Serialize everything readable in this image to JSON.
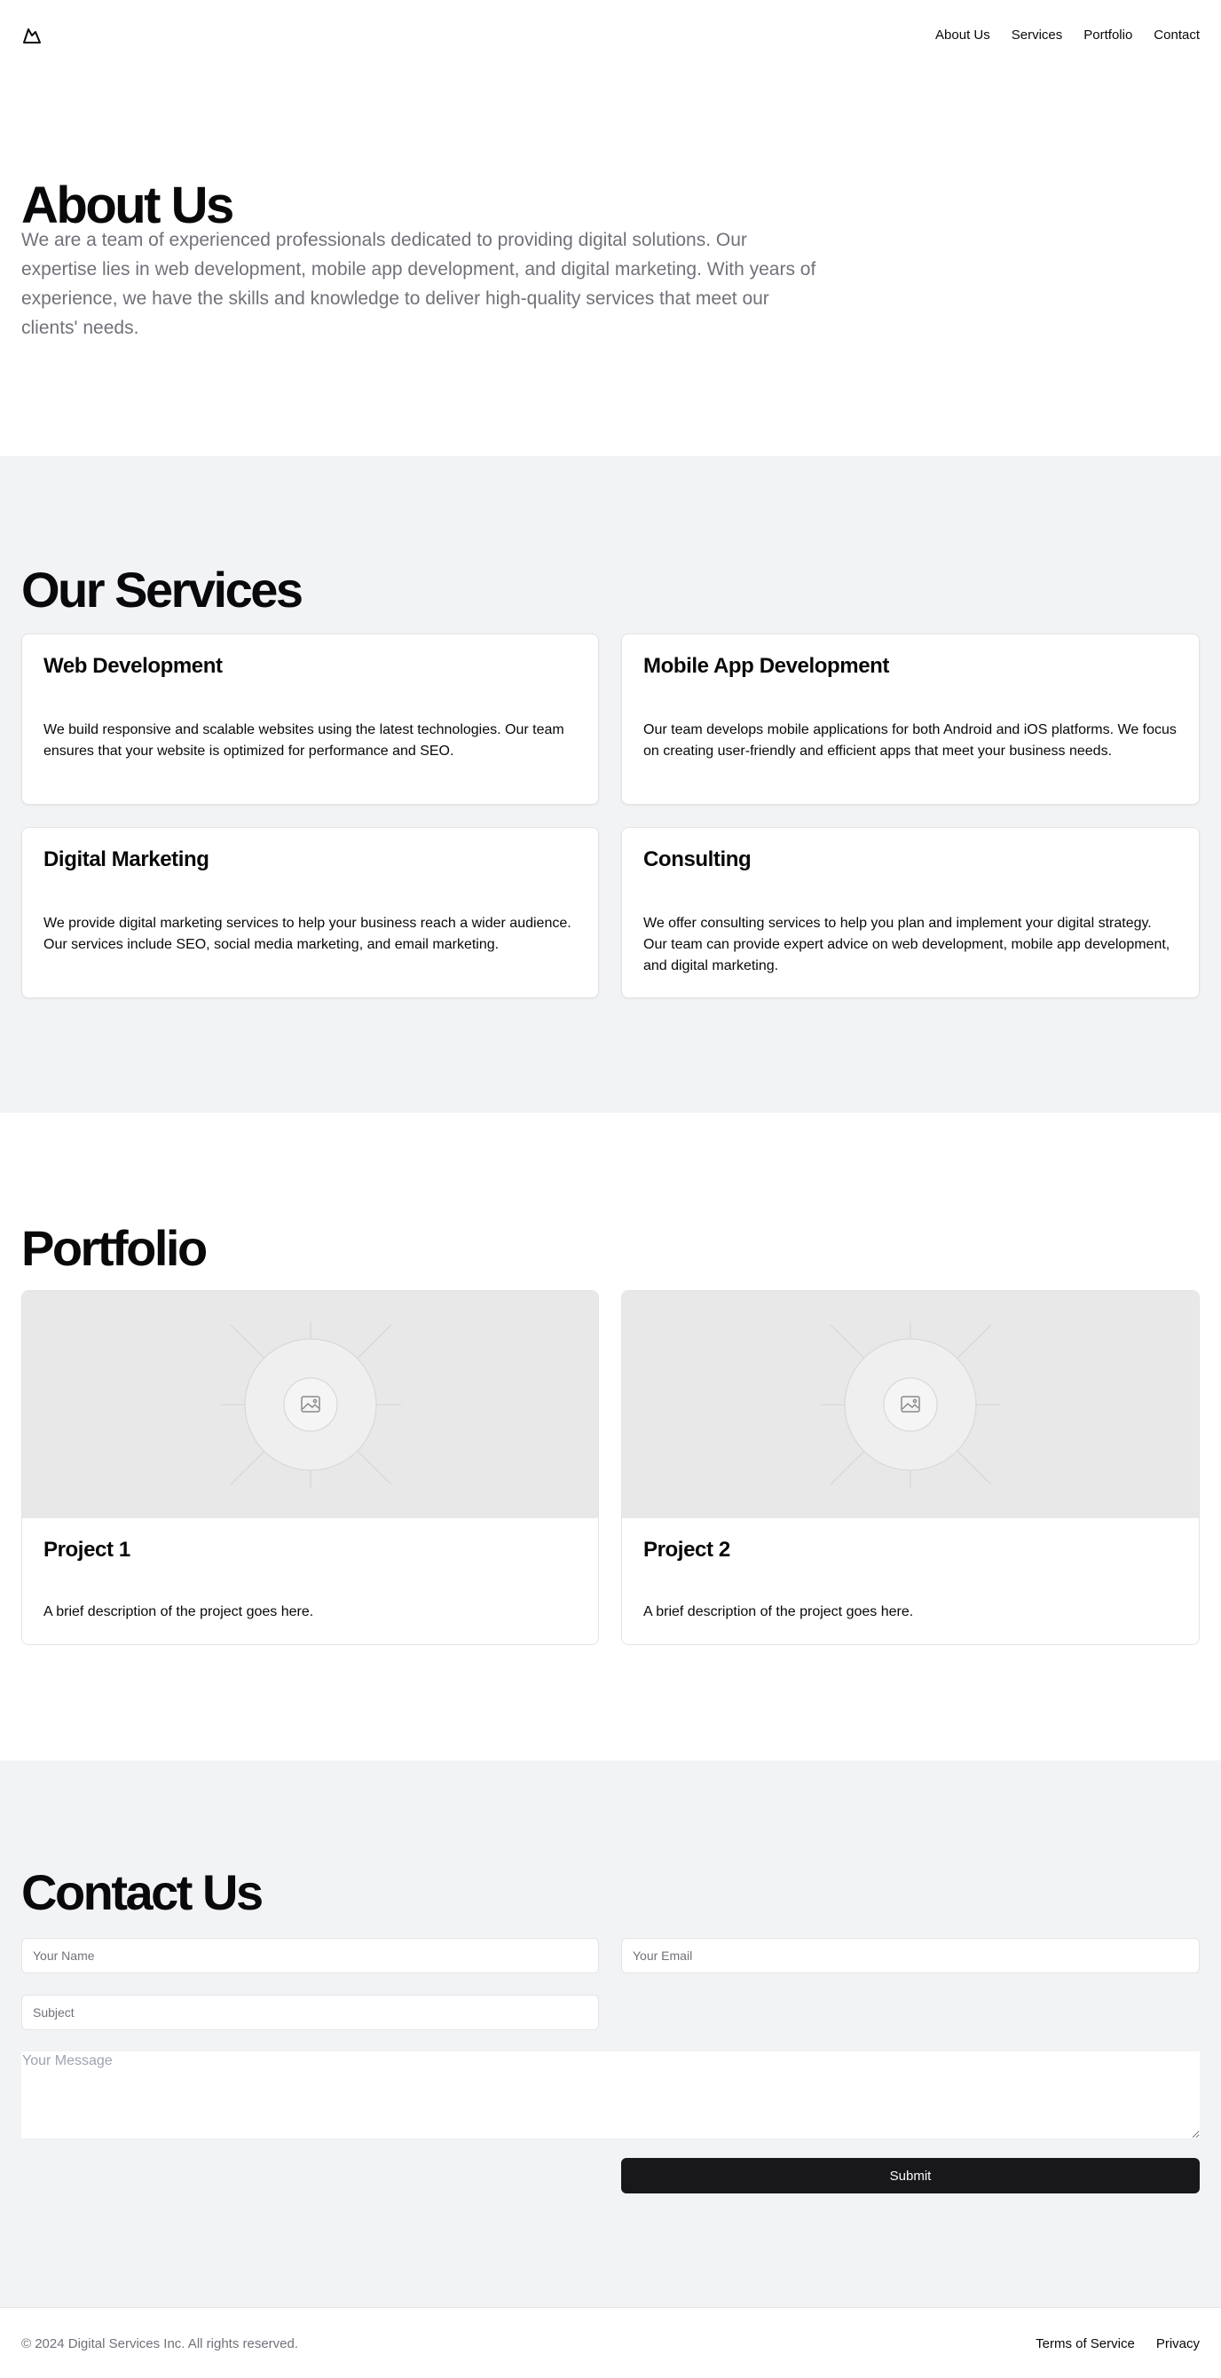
{
  "header": {
    "logo_icon": "mountain-icon",
    "nav": [
      {
        "label": "About Us"
      },
      {
        "label": "Services"
      },
      {
        "label": "Portfolio"
      },
      {
        "label": "Contact"
      }
    ]
  },
  "about": {
    "title": "About Us",
    "body": "We are a team of experienced professionals dedicated to providing digital solutions. Our expertise lies in web development, mobile app development, and digital marketing. With years of experience, we have the skills and knowledge to deliver high-quality services that meet our clients' needs."
  },
  "services": {
    "title": "Our Services",
    "items": [
      {
        "title": "Web Development",
        "body": "We build responsive and scalable websites using the latest technologies. Our team ensures that your website is optimized for performance and SEO."
      },
      {
        "title": "Mobile App Development",
        "body": "Our team develops mobile applications for both Android and iOS platforms. We focus on creating user-friendly and efficient apps that meet your business needs."
      },
      {
        "title": "Digital Marketing",
        "body": "We provide digital marketing services to help your business reach a wider audience. Our services include SEO, social media marketing, and email marketing."
      },
      {
        "title": "Consulting",
        "body": "We offer consulting services to help you plan and implement your digital strategy. Our team can provide expert advice on web development, mobile app development, and digital marketing."
      }
    ]
  },
  "portfolio": {
    "title": "Portfolio",
    "items": [
      {
        "title": "Project 1",
        "body": "A brief description of the project goes here.",
        "image_icon": "image-placeholder-icon"
      },
      {
        "title": "Project 2",
        "body": "A brief description of the project goes here.",
        "image_icon": "image-placeholder-icon"
      }
    ]
  },
  "contact": {
    "title": "Contact Us",
    "name_placeholder": "Your Name",
    "email_placeholder": "Your Email",
    "subject_placeholder": "Subject",
    "message_placeholder": "Your Message",
    "submit_label": "Submit"
  },
  "footer": {
    "copyright": "© 2024 Digital Services Inc. All rights reserved.",
    "links": [
      {
        "label": "Terms of Service"
      },
      {
        "label": "Privacy"
      }
    ]
  },
  "colors": {
    "section_alt_bg": "#f2f3f5",
    "primary_button": "#18181b",
    "muted_text": "#71717a"
  }
}
